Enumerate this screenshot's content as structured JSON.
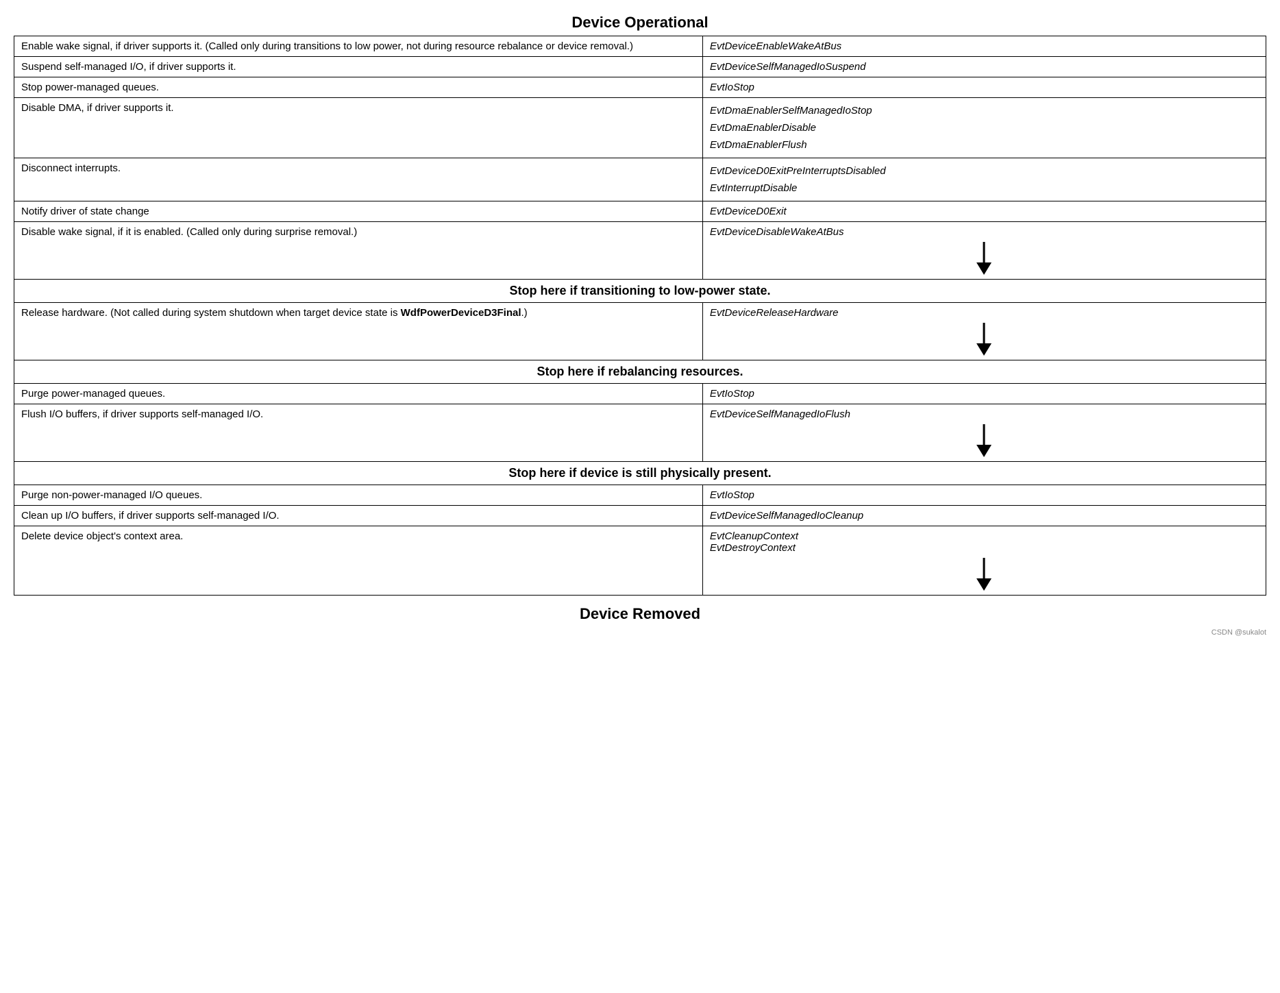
{
  "page": {
    "title": "Device Operational",
    "footer": "Device Removed",
    "watermark": "CSDN @sukalot",
    "stop_labels": {
      "low_power": "Stop here if transitioning to low-power state.",
      "rebalancing": "Stop here if rebalancing resources.",
      "physically_present": "Stop here if device is still physically present."
    },
    "rows": [
      {
        "left": "Enable wake signal, if driver supports it. (Called only during transitions to low power, not during resource rebalance or device removal.)",
        "right": [
          "EvtDeviceEnableWakeAtBus"
        ],
        "has_arrow": false
      },
      {
        "left": "Suspend self-managed I/O, if driver supports it.",
        "right": [
          "EvtDeviceSelfManagedIoSuspend"
        ],
        "has_arrow": false
      },
      {
        "left": "Stop power-managed queues.",
        "right": [
          "EvtIoStop"
        ],
        "has_arrow": false
      },
      {
        "left": "Disable DMA, if driver supports it.",
        "right": [
          "EvtDmaEnablerSelfManagedIoStop",
          "EvtDmaEnablerDisable",
          "EvtDmaEnablerFlush"
        ],
        "has_arrow": false
      },
      {
        "left": "Disconnect interrupts.",
        "right": [
          "EvtDeviceD0ExitPreInterruptsDisabled",
          "EvtInterruptDisable"
        ],
        "has_arrow": false
      },
      {
        "left": "Notify driver of state change",
        "right": [
          "EvtDeviceD0Exit"
        ],
        "has_arrow": false
      },
      {
        "left": "Disable wake signal, if it is enabled. (Called only during surprise removal.)",
        "right": [
          "EvtDeviceDisableWakeAtBus"
        ],
        "has_arrow": true
      }
    ],
    "section2_rows": [
      {
        "left": "Release hardware. (Not called during system shutdown when target device state is WdfPowerDeviceD3Final.)",
        "left_bold": "WdfPowerDeviceD3Final",
        "right": [
          "EvtDeviceReleaseHardware"
        ],
        "has_arrow": true
      }
    ],
    "section3_rows": [
      {
        "left": "Purge power-managed queues.",
        "right": [
          "EvtIoStop"
        ],
        "has_arrow": false
      },
      {
        "left": "Flush I/O buffers, if driver supports self-managed I/O.",
        "right": [
          "EvtDeviceSelfManagedIoFlush"
        ],
        "has_arrow": true
      }
    ],
    "section4_rows": [
      {
        "left": "Purge non-power-managed I/O queues.",
        "right": [
          "EvtIoStop"
        ],
        "has_arrow": false
      },
      {
        "left": "Clean up I/O buffers, if driver supports self-managed I/O.",
        "right": [
          "EvtDeviceSelfManagedIoCleanup"
        ],
        "has_arrow": false
      },
      {
        "left": "Delete device object's context area.",
        "right": [
          "EvtCleanupContext",
          "EvtDestroyContext"
        ],
        "has_arrow": true
      }
    ]
  }
}
